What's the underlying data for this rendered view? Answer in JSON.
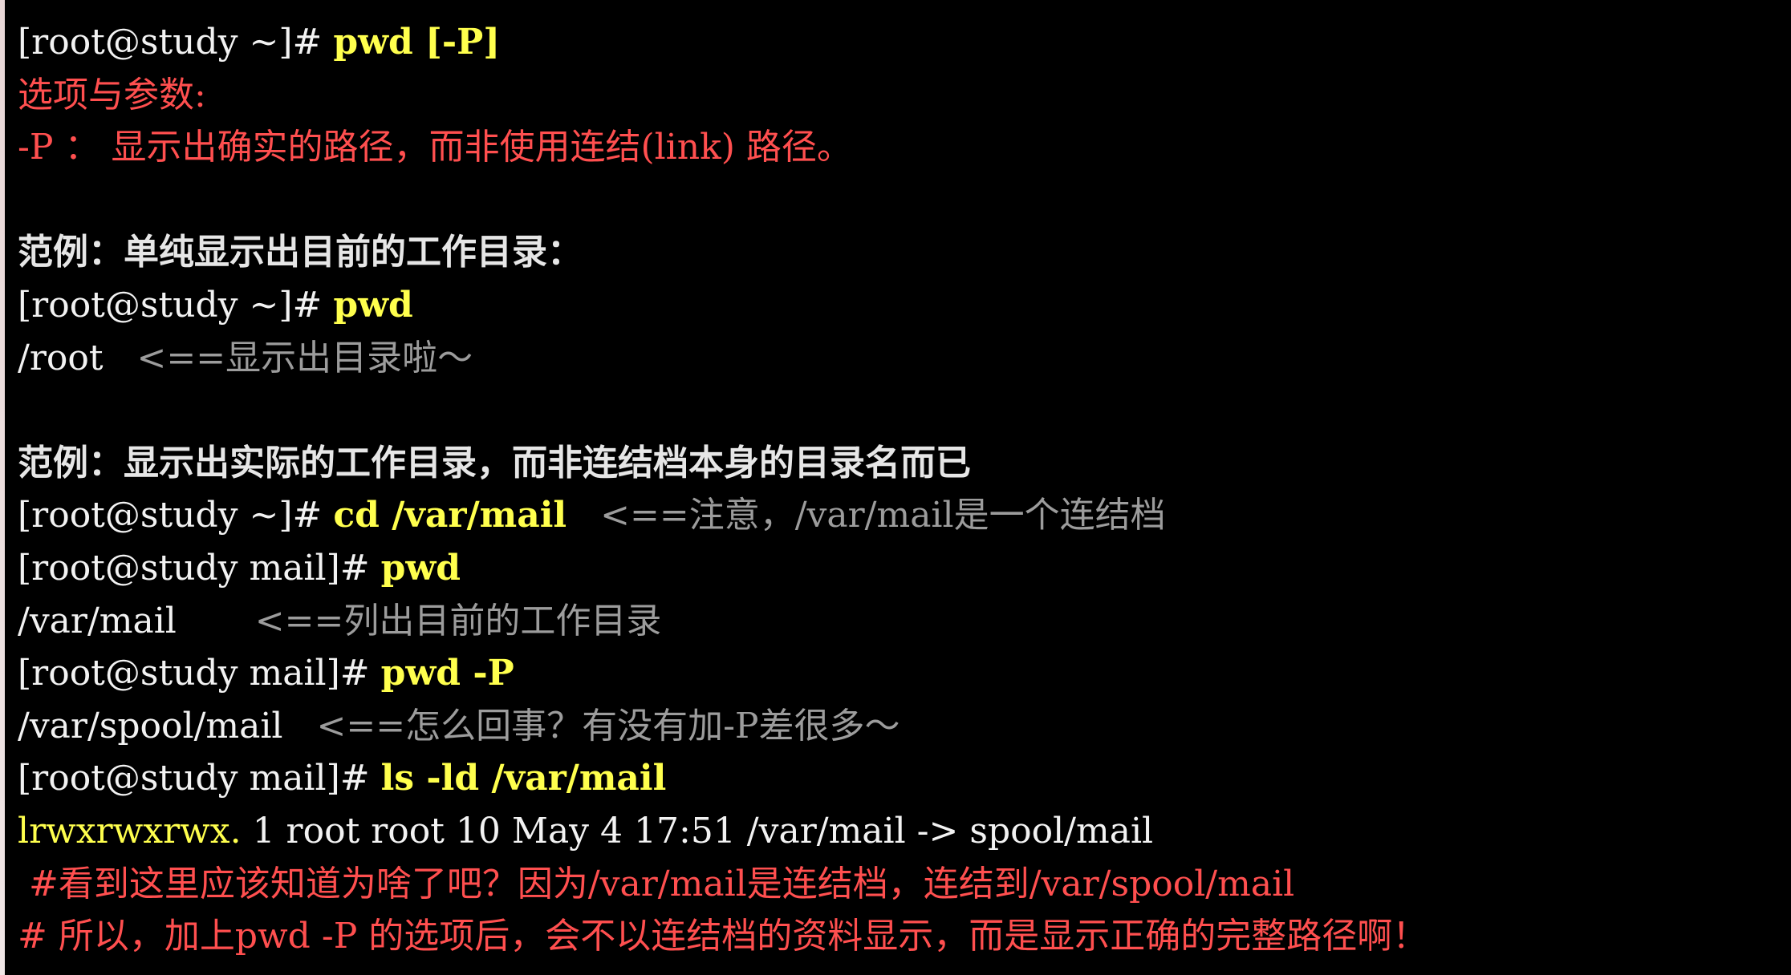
{
  "lines": [
    {
      "prompt": "[root@study ~]# ",
      "cmd": "pwd [-P]"
    },
    {
      "text": "选项与参数:"
    },
    {
      "text": "-P ： 显示出确实的路径，而非使用连结(link) 路径。"
    },
    {
      "blank": ""
    },
    {
      "text": "范例：单纯显示出目前的工作目录："
    },
    {
      "prompt": "[root@study ~]# ",
      "cmd": "pwd"
    },
    {
      "output": "/root",
      "spacer": "   ",
      "comment": "<==显示出目录啦～"
    },
    {
      "blank": ""
    },
    {
      "text": "范例：显示出实际的工作目录，而非连结档本身的目录名而已"
    },
    {
      "prompt": "[root@study ~]# ",
      "cmd": "cd /var/mail",
      "spacer": "   ",
      "comment": "<==注意，/var/mail是一个连结档"
    },
    {
      "prompt": "[root@study mail]# ",
      "cmd": "pwd"
    },
    {
      "output": "/var/mail",
      "spacer": "       ",
      "comment": "<==列出目前的工作目录"
    },
    {
      "prompt": "[root@study mail]# ",
      "cmd": "pwd -P"
    },
    {
      "output": "/var/spool/mail",
      "spacer": "   ",
      "comment": "<==怎么回事？有没有加-P差很多～"
    },
    {
      "prompt": "[root@study mail]# ",
      "cmd": "ls -ld /var/mail"
    },
    {
      "perm": "lrwxrwxrwx.",
      "rest": " 1 root root 10 May 4 17:51 /var/mail -> spool/mail"
    },
    {
      "text": " #看到这里应该知道为啥了吧？因为/var/mail是连结档，连结到/var/spool/mail"
    },
    {
      "text": "# 所以，加上pwd -P 的选项后，会不以连结档的资料显示，而是显示正确的完整路径啊！"
    }
  ]
}
